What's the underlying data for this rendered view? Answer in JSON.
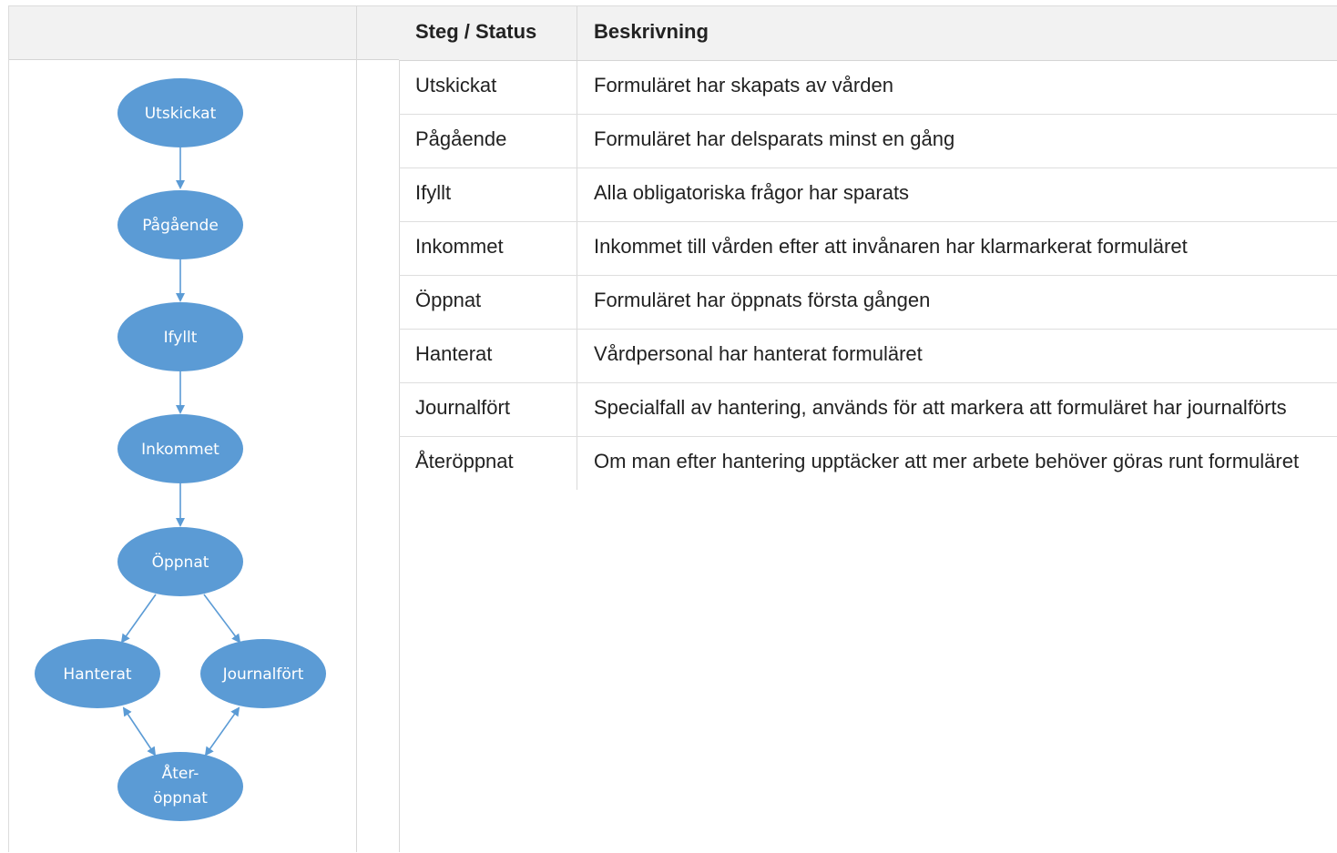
{
  "table": {
    "headers": {
      "status": "Steg / Status",
      "description": "Beskrivning"
    },
    "rows": [
      {
        "status": "Utskickat",
        "description": "Formuläret har skapats av vården"
      },
      {
        "status": "Pågående",
        "description": "Formuläret har delsparats minst en gång"
      },
      {
        "status": "Ifyllt",
        "description": "Alla obligatoriska frågor har sparats"
      },
      {
        "status": "Inkommet",
        "description": "Inkommet till vården efter att invånaren har klarmarkerat formuläret"
      },
      {
        "status": "Öppnat",
        "description": "Formuläret har öppnats första gången"
      },
      {
        "status": "Hanterat",
        "description": "Vårdpersonal har hanterat formuläret"
      },
      {
        "status": "Journalfört",
        "description": "Specialfall av hantering, används för att markera att formuläret har journalförts"
      },
      {
        "status": "Återöppnat",
        "description": "Om man efter hantering upptäcker att mer arbete behöver göras runt formuläret"
      }
    ]
  },
  "diagram": {
    "nodes": {
      "utskickat": "Utskickat",
      "pagaende": "Pågående",
      "ifyllt": "Ifyllt",
      "inkommet": "Inkommet",
      "oppnat": "Öppnat",
      "hanterat": "Hanterat",
      "journalfort": "Journalfört",
      "ateroppnat_line1": "Åter-",
      "ateroppnat_line2": "öppnat"
    },
    "colors": {
      "node_fill": "#5b9bd5",
      "arrow": "#5b9bd5"
    }
  }
}
